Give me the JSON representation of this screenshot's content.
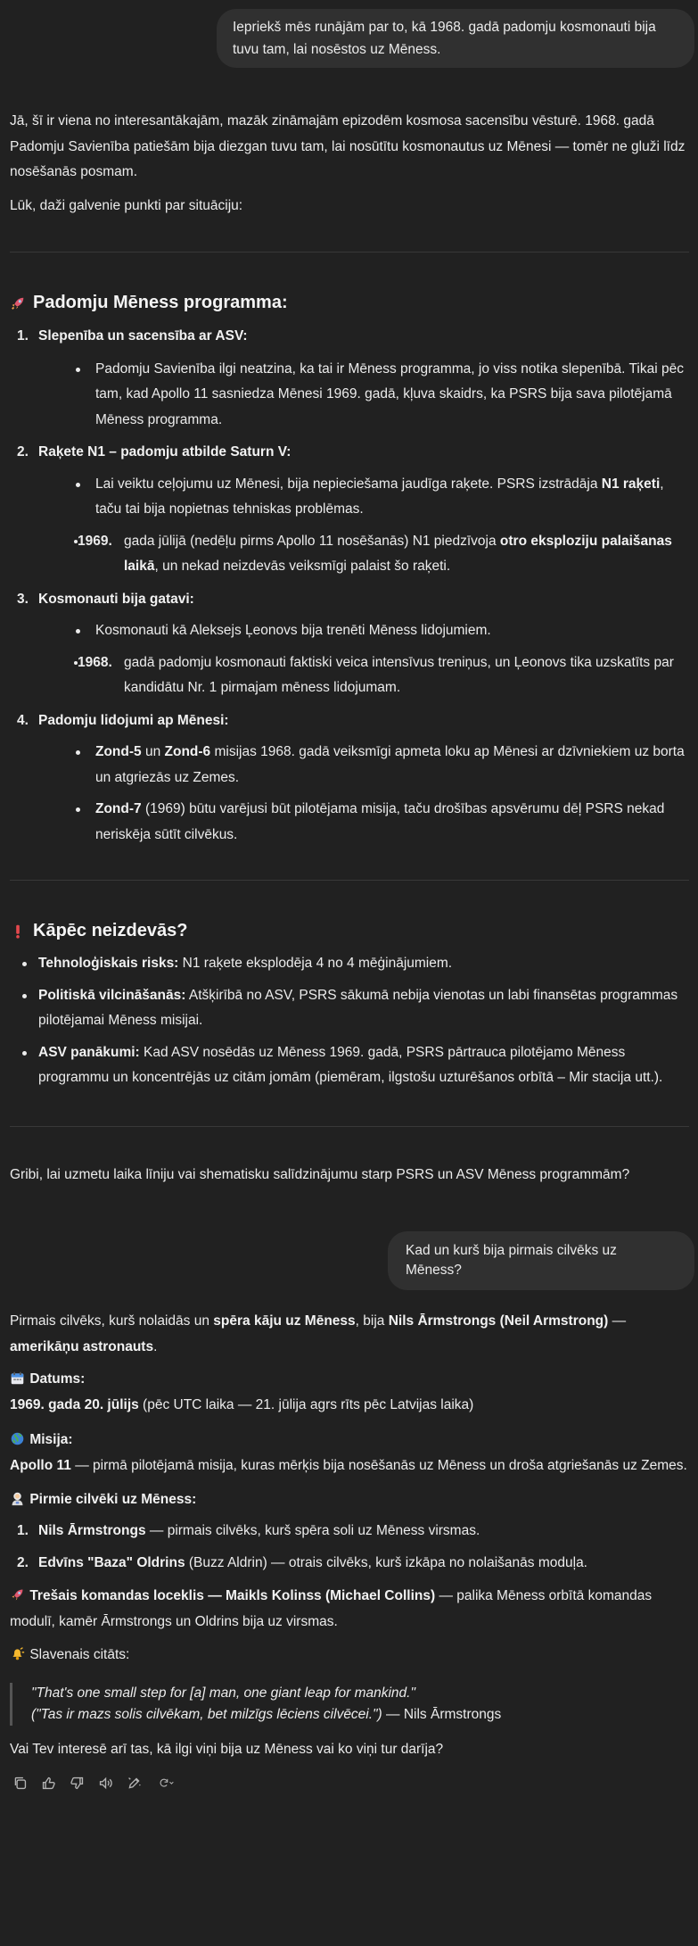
{
  "user1": "Iepriekš mēs runājām par to, kā 1968. gadā padomju kosmonauti bija tuvu tam, lai nosēstos uz Mēness.",
  "intro": {
    "p1": "Jā, šī ir viena no interesantākajām, mazāk zināmajām epizodēm kosmosa sacensību vēsturē. 1968. gadā Padomju Savienība patiešām bija diezgan tuvu tam, lai nosūtītu kosmonautus uz Mēnesi — tomēr ne gluži līdz nosēšanās posmam.",
    "p2": "Lūk, daži galvenie punkti par situāciju:"
  },
  "section1": {
    "icon": "rocket-icon",
    "title": "Padomju Mēness programma:",
    "items": [
      {
        "num": "1.",
        "heading": "Slepenība un sacensība ar ASV:",
        "b1": "Padomju Savienība ilgi neatzina, ka tai ir Mēness programma, jo viss notika slepenībā. Tikai pēc tam, kad Apollo 11 sasniedza Mēnesi 1969. gadā, kļuva skaidrs, ka PSRS bija sava pilotējamā Mēness programma."
      },
      {
        "num": "2.",
        "heading": "Raķete N1 – padomju atbilde Saturn V:",
        "b1a": "Lai veiktu ceļojumu uz Mēnesi, bija nepieciešama jaudīga raķete. PSRS izstrādāja ",
        "b1b": "N1 raķeti",
        "b1c": ", taču tai bija nopietnas tehniskas problēmas.",
        "year": "1969.",
        "b2a": "gada jūlijā (nedēļu pirms Apollo 11 nosēšanās) N1 piedzīvoja ",
        "b2b": "otro eksploziju palaišanas laikā",
        "b2c": ", un nekad neizdevās veiksmīgi palaist šo raķeti."
      },
      {
        "num": "3.",
        "heading": "Kosmonauti bija gatavi:",
        "b1": "Kosmonauti kā Aleksejs Ļeonovs bija trenēti Mēness lidojumiem.",
        "year": "1968.",
        "b2": "gadā padomju kosmonauti faktiski veica intensīvus treniņus, un Ļeonovs tika uzskatīts par kandidātu Nr. 1 pirmajam mēness lidojumam."
      },
      {
        "num": "4.",
        "heading": "Padomju lidojumi ap Mēnesi:",
        "b1a": "Zond-5",
        "b1b": " un ",
        "b1c": "Zond-6",
        "b1d": " misijas 1968. gadā veiksmīgi apmeta loku ap Mēnesi ar dzīvniekiem uz borta un atgriezās uz Zemes.",
        "b2a": "Zond-7",
        "b2b": " (1969) būtu varējusi būt pilotējama misija, taču drošības apsvērumu dēļ PSRS nekad neriskēja sūtīt cilvēkus."
      }
    ]
  },
  "section2": {
    "icon": "exclamation-icon",
    "title": "Kāpēc neizdevās?",
    "items": [
      {
        "label": "Tehnoloģiskais risks:",
        "text": " N1 raķete eksplodēja 4 no 4 mēģinājumiem."
      },
      {
        "label": "Politiskā vilcināšanās:",
        "text": " Atšķirībā no ASV, PSRS sākumā nebija vienotas un labi finansētas programmas pilotējamai Mēness misijai."
      },
      {
        "label": "ASV panākumi:",
        "text": " Kad ASV nosēdās uz Mēness 1969. gadā, PSRS pārtrauca pilotējamo Mēness programmu un koncentrējās uz citām jomām (piemēram, ilgstošu uzturēšanos orbītā – Mir stacija utt.)."
      }
    ]
  },
  "closing1": "Gribi, lai uzmetu laika līniju vai shematisku salīdzinājumu starp PSRS un ASV Mēness programmām?",
  "user2": "Kad un kurš bija pirmais cilvēks uz Mēness?",
  "answer": {
    "p1a": "Pirmais cilvēks, kurš nolaidās un ",
    "p1b": "spēra kāju uz Mēness",
    "p1c": ", bija ",
    "p1d": "Nils Ārmstrongs (Neil Armstrong)",
    "p1e": " — ",
    "p1f": "amerikāņu astronauts",
    "p1g": ".",
    "date_label": "Datums:",
    "date_bold": "1969. gada 20. jūlijs",
    "date_rest": " (pēc UTC laika — 21. jūlija agrs rīts pēc Latvijas laika)",
    "mission_label": "Misija:",
    "mission_bold": "Apollo 11",
    "mission_rest": " — pirmā pilotējamā misija, kuras mērķis bija nosēšanās uz Mēness un droša atgriešanās uz Zemes.",
    "first_label": "Pirmie cilvēki uz Mēness:",
    "people": [
      {
        "num": "1.",
        "name": "Nils Ārmstrongs",
        "rest": " — pirmais cilvēks, kurš spēra soli uz Mēness virsmas."
      },
      {
        "num": "2.",
        "name": "Edvīns \"Baza\" Oldrins",
        "rest": " (Buzz Aldrin) — otrais cilvēks, kurš izkāpa no nolaišanās moduļa."
      }
    ],
    "third_bold": "Trešais komandas loceklis — Maikls Kolinss (Michael Collins)",
    "third_rest": " — palika Mēness orbītā komandas modulī, kamēr Ārmstrongs un Oldrins bija uz virsmas.",
    "quote_label": "Slavenais citāts:",
    "quote_en": "\"That's one small step for [a] man, one giant leap for mankind.\"",
    "quote_lv": "(\"Tas ir mazs solis cilvēkam, bet milzīgs lēciens cilvēcei.\")",
    "quote_author": " — Nils Ārmstrongs",
    "closing": "Vai Tev interesē arī tas, kā ilgi viņi bija uz Mēness vai ko viņi tur darīja?"
  },
  "icons": {
    "date": "calendar-icon",
    "mission": "globe-icon",
    "first": "astronaut-icon",
    "third": "rocket-icon",
    "quote": "bell-icon"
  },
  "actions": [
    "copy-icon",
    "thumbs-up-icon",
    "thumbs-down-icon",
    "speaker-icon",
    "edit-icon",
    "regenerate-icon"
  ],
  "colors": {
    "background": "#212121",
    "bubble": "#303030",
    "text": "#ececec",
    "accent_red": "#e5484d",
    "rocket": "#e0566c"
  }
}
